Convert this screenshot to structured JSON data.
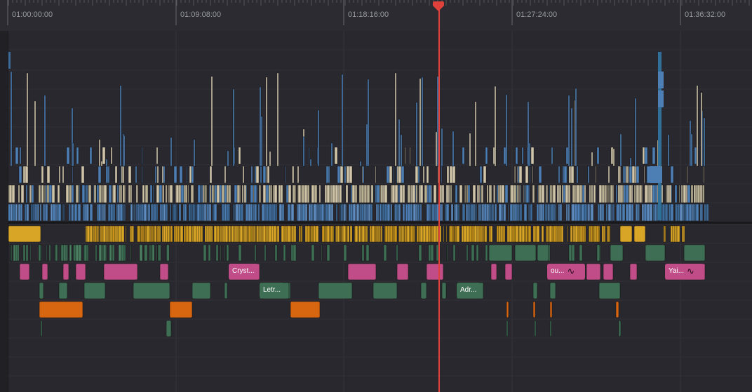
{
  "ruler": {
    "timecodes": [
      "01:00:00:00",
      "01:09:08:00",
      "01:18:16:00",
      "01:27:24:00",
      "01:36:32:00"
    ]
  },
  "colors": {
    "video_blue": "#4d7eb4",
    "video_beige": "#cfc4a8",
    "audio_yellow": "#d9a526",
    "audio_green": "#3e6e54",
    "audio_pink": "#c04c88",
    "audio_orange": "#d8650f",
    "playhead": "#e0413a"
  },
  "clip_labels": [
    {
      "text": "Cryst...",
      "track": "A3"
    },
    {
      "text": "Letr...",
      "track": "A4"
    },
    {
      "text": "Adr...",
      "track": "A4"
    },
    {
      "text": "ou...",
      "track": "A3",
      "icon": "waveform-icon"
    },
    {
      "text": "Yai...",
      "track": "A3",
      "icon": "waveform-icon"
    }
  ],
  "playhead": {
    "icon": "playhead-marker-icon"
  }
}
